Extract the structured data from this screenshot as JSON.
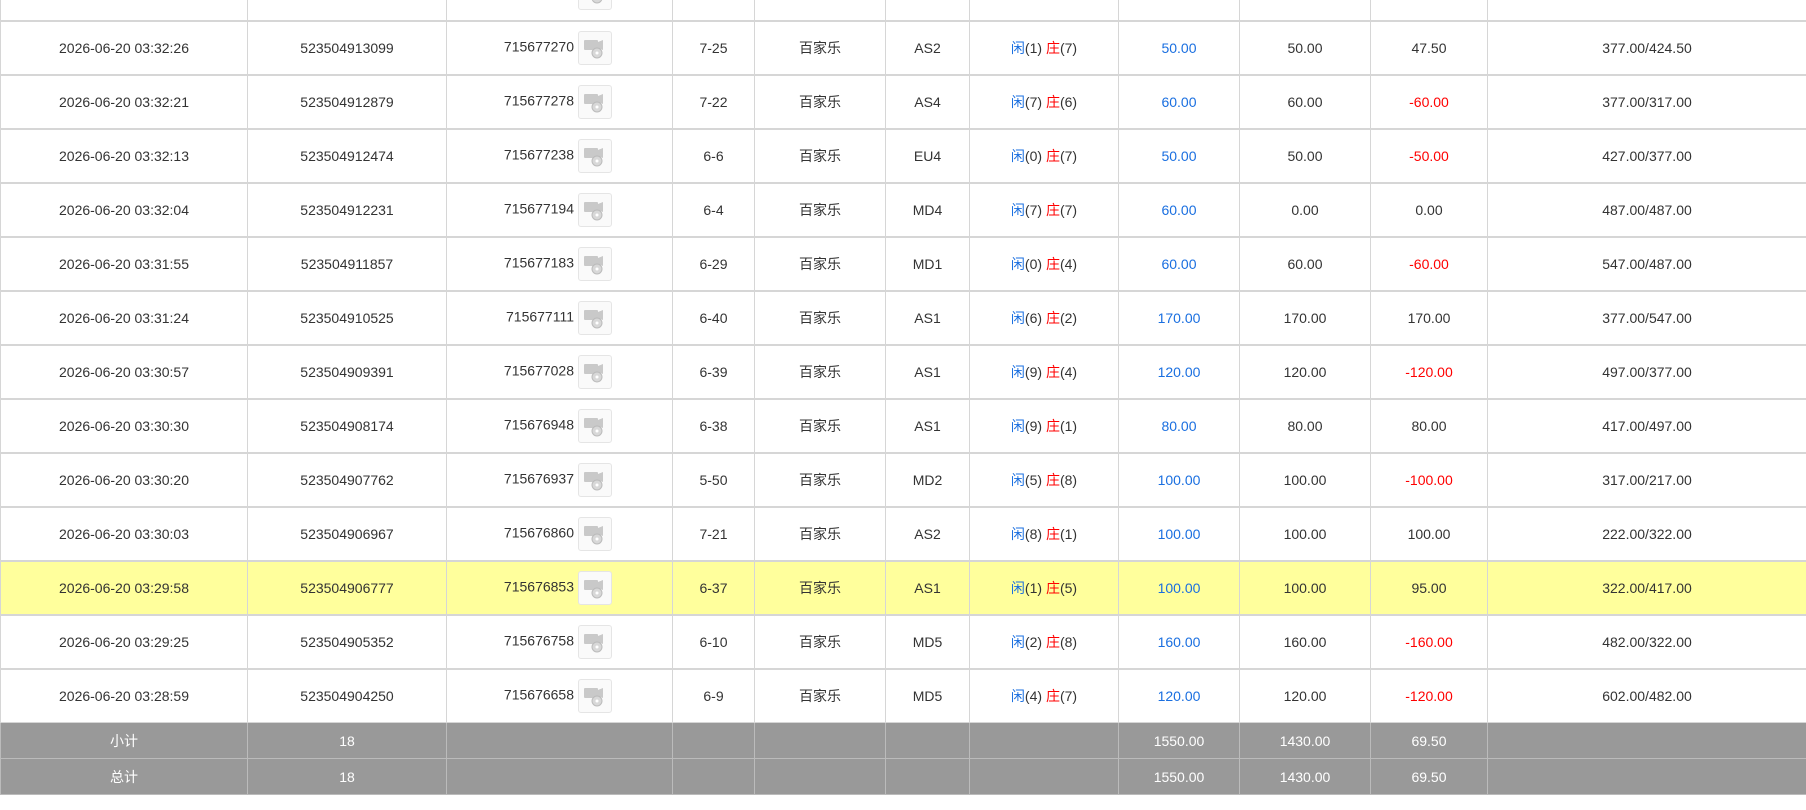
{
  "columns": [
    "time",
    "bet_no",
    "round_no",
    "shoe",
    "game",
    "table",
    "result",
    "bet",
    "valid",
    "winloss",
    "balance"
  ],
  "rows": [
    {
      "time": "",
      "bet_no": "",
      "round_no": "",
      "shoe": "",
      "game": "",
      "table": "",
      "p": "",
      "b": "",
      "bet": "",
      "valid": "",
      "winloss": "",
      "balance": "",
      "top": true
    },
    {
      "time": "2026-06-20 03:32:26",
      "bet_no": "523504913099",
      "round_no": "715677270",
      "shoe": "7-25",
      "game": "百家乐",
      "table": "AS2",
      "p": "1",
      "b": "7",
      "bet": "50.00",
      "valid": "50.00",
      "winloss": "47.50",
      "balance": "377.00/424.50"
    },
    {
      "time": "2026-06-20 03:32:21",
      "bet_no": "523504912879",
      "round_no": "715677278",
      "shoe": "7-22",
      "game": "百家乐",
      "table": "AS4",
      "p": "7",
      "b": "6",
      "bet": "60.00",
      "valid": "60.00",
      "winloss": "-60.00",
      "balance": "377.00/317.00"
    },
    {
      "time": "2026-06-20 03:32:13",
      "bet_no": "523504912474",
      "round_no": "715677238",
      "shoe": "6-6",
      "game": "百家乐",
      "table": "EU4",
      "p": "0",
      "b": "7",
      "bet": "50.00",
      "valid": "50.00",
      "winloss": "-50.00",
      "balance": "427.00/377.00"
    },
    {
      "time": "2026-06-20 03:32:04",
      "bet_no": "523504912231",
      "round_no": "715677194",
      "shoe": "6-4",
      "game": "百家乐",
      "table": "MD4",
      "p": "7",
      "b": "7",
      "bet": "60.00",
      "valid": "0.00",
      "winloss": "0.00",
      "balance": "487.00/487.00"
    },
    {
      "time": "2026-06-20 03:31:55",
      "bet_no": "523504911857",
      "round_no": "715677183",
      "shoe": "6-29",
      "game": "百家乐",
      "table": "MD1",
      "p": "0",
      "b": "4",
      "bet": "60.00",
      "valid": "60.00",
      "winloss": "-60.00",
      "balance": "547.00/487.00"
    },
    {
      "time": "2026-06-20 03:31:24",
      "bet_no": "523504910525",
      "round_no": "715677111",
      "shoe": "6-40",
      "game": "百家乐",
      "table": "AS1",
      "p": "6",
      "b": "2",
      "bet": "170.00",
      "valid": "170.00",
      "winloss": "170.00",
      "balance": "377.00/547.00"
    },
    {
      "time": "2026-06-20 03:30:57",
      "bet_no": "523504909391",
      "round_no": "715677028",
      "shoe": "6-39",
      "game": "百家乐",
      "table": "AS1",
      "p": "9",
      "b": "4",
      "bet": "120.00",
      "valid": "120.00",
      "winloss": "-120.00",
      "balance": "497.00/377.00"
    },
    {
      "time": "2026-06-20 03:30:30",
      "bet_no": "523504908174",
      "round_no": "715676948",
      "shoe": "6-38",
      "game": "百家乐",
      "table": "AS1",
      "p": "9",
      "b": "1",
      "bet": "80.00",
      "valid": "80.00",
      "winloss": "80.00",
      "balance": "417.00/497.00"
    },
    {
      "time": "2026-06-20 03:30:20",
      "bet_no": "523504907762",
      "round_no": "715676937",
      "shoe": "5-50",
      "game": "百家乐",
      "table": "MD2",
      "p": "5",
      "b": "8",
      "bet": "100.00",
      "valid": "100.00",
      "winloss": "-100.00",
      "balance": "317.00/217.00"
    },
    {
      "time": "2026-06-20 03:30:03",
      "bet_no": "523504906967",
      "round_no": "715676860",
      "shoe": "7-21",
      "game": "百家乐",
      "table": "AS2",
      "p": "8",
      "b": "1",
      "bet": "100.00",
      "valid": "100.00",
      "winloss": "100.00",
      "balance": "222.00/322.00"
    },
    {
      "time": "2026-06-20 03:29:58",
      "bet_no": "523504906777",
      "round_no": "715676853",
      "shoe": "6-37",
      "game": "百家乐",
      "table": "AS1",
      "p": "1",
      "b": "5",
      "bet": "100.00",
      "valid": "100.00",
      "winloss": "95.00",
      "balance": "322.00/417.00",
      "highlight": true
    },
    {
      "time": "2026-06-20 03:29:25",
      "bet_no": "523504905352",
      "round_no": "715676758",
      "shoe": "6-10",
      "game": "百家乐",
      "table": "MD5",
      "p": "2",
      "b": "8",
      "bet": "160.00",
      "valid": "160.00",
      "winloss": "-160.00",
      "balance": "482.00/322.00"
    },
    {
      "time": "2026-06-20 03:28:59",
      "bet_no": "523504904250",
      "round_no": "715676658",
      "shoe": "6-9",
      "game": "百家乐",
      "table": "MD5",
      "p": "4",
      "b": "7",
      "bet": "120.00",
      "valid": "120.00",
      "winloss": "-120.00",
      "balance": "602.00/482.00"
    }
  ],
  "labels": {
    "player": "闲",
    "banker": "庄"
  },
  "summary": [
    {
      "label": "小计",
      "count": "18",
      "bet": "1550.00",
      "valid": "1430.00",
      "winloss": "69.50"
    },
    {
      "label": "总计",
      "count": "18",
      "bet": "1550.00",
      "valid": "1430.00",
      "winloss": "69.50"
    }
  ],
  "colors": {
    "blue": "#1a6fe0",
    "red": "#ff0000",
    "highlight": "#ffff9c",
    "summary_bg": "#999999"
  }
}
